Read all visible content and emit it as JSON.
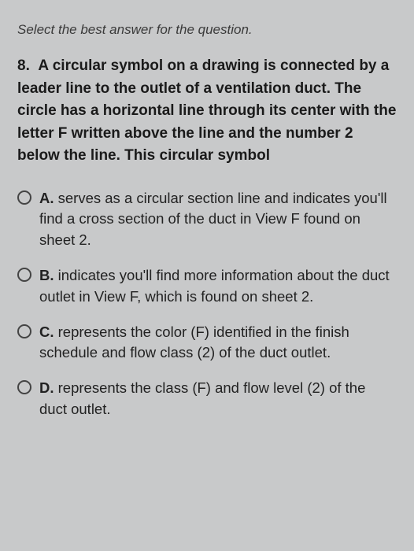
{
  "instruction": "Select the best answer for the question.",
  "question": {
    "number": "8.",
    "text": "A circular symbol on a drawing is connected by a leader line to the outlet of a ventilation duct. The circle has a horizontal line through its center with the letter F written above the line and the number 2 below the line. This circular symbol"
  },
  "options": [
    {
      "letter": "A.",
      "text": "serves as a circular section line and indicates you'll find a cross section of the duct in View F found on sheet 2."
    },
    {
      "letter": "B.",
      "text": "indicates you'll find more information about the duct outlet in View F, which is found on sheet 2."
    },
    {
      "letter": "C.",
      "text": "represents the color (F) identified in the finish schedule and flow class (2) of the duct outlet."
    },
    {
      "letter": "D.",
      "text": "represents the class (F) and flow level (2) of the duct outlet."
    }
  ]
}
